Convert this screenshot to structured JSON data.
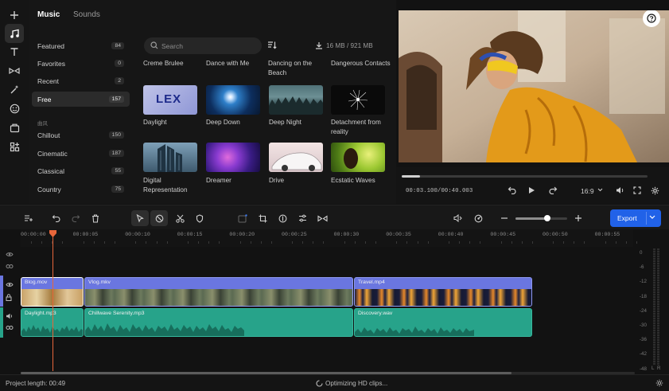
{
  "library": {
    "tabs": {
      "music": "Music",
      "sounds": "Sounds"
    },
    "categories": [
      {
        "label": "Featured",
        "count": "84"
      },
      {
        "label": "Favorites",
        "count": "0"
      },
      {
        "label": "Recent",
        "count": "2"
      },
      {
        "label": "Free",
        "count": "157"
      }
    ],
    "genre_header": "曲风",
    "genres": [
      {
        "label": "Chillout",
        "count": "150"
      },
      {
        "label": "Cinematic",
        "count": "187"
      },
      {
        "label": "Classical",
        "count": "55"
      },
      {
        "label": "Country",
        "count": "75"
      }
    ],
    "search_placeholder": "Search",
    "storage": "16 MB / 921 MB",
    "partial_titles": [
      "Creme Brulee",
      "Dance with Me",
      "Dancing on the Beach",
      "Dangerous Contacts"
    ],
    "tracks": [
      {
        "title": "Daylight"
      },
      {
        "title": "Deep Down"
      },
      {
        "title": "Deep Night"
      },
      {
        "title": "Detachment from reality"
      },
      {
        "title": "Digital Representation"
      },
      {
        "title": "Dreamer"
      },
      {
        "title": "Drive"
      },
      {
        "title": "Ecstatic Waves"
      }
    ],
    "lex_text": "LEX"
  },
  "player": {
    "timecode": "00:03.100/00:40.003",
    "aspect": "16:9",
    "progress": 0.076
  },
  "toolbar": {
    "export_label": "Export"
  },
  "timeline": {
    "ticks": [
      "00:00:00",
      "00:00:05",
      "00:00:10",
      "00:00:15",
      "00:00:20",
      "00:00:25",
      "00:00:30",
      "00:00:35",
      "00:00:40",
      "00:00:45",
      "00:00:50",
      "00:00:55"
    ],
    "video_clips": [
      {
        "name": "Blog.mov"
      },
      {
        "name": "Vlog.mkv"
      },
      {
        "name": "Travel.mp4"
      }
    ],
    "audio_clips": [
      {
        "name": "Daylight.mp3"
      },
      {
        "name": "Chillwave Serenity.mp3"
      },
      {
        "name": "Discovery.wav"
      }
    ],
    "meter_labels": [
      "0",
      "-6",
      "-12",
      "-18",
      "-24",
      "-30",
      "-36",
      "-42",
      "-48",
      "L",
      "R"
    ]
  },
  "footer": {
    "project_length": "Project length: 00:49",
    "status": "Optimizing HD clips..."
  },
  "colors": {
    "accent": "#2162e8",
    "video_clip": "#6a76e0",
    "audio_clip": "#27a38a",
    "playhead": "#e8663a"
  }
}
